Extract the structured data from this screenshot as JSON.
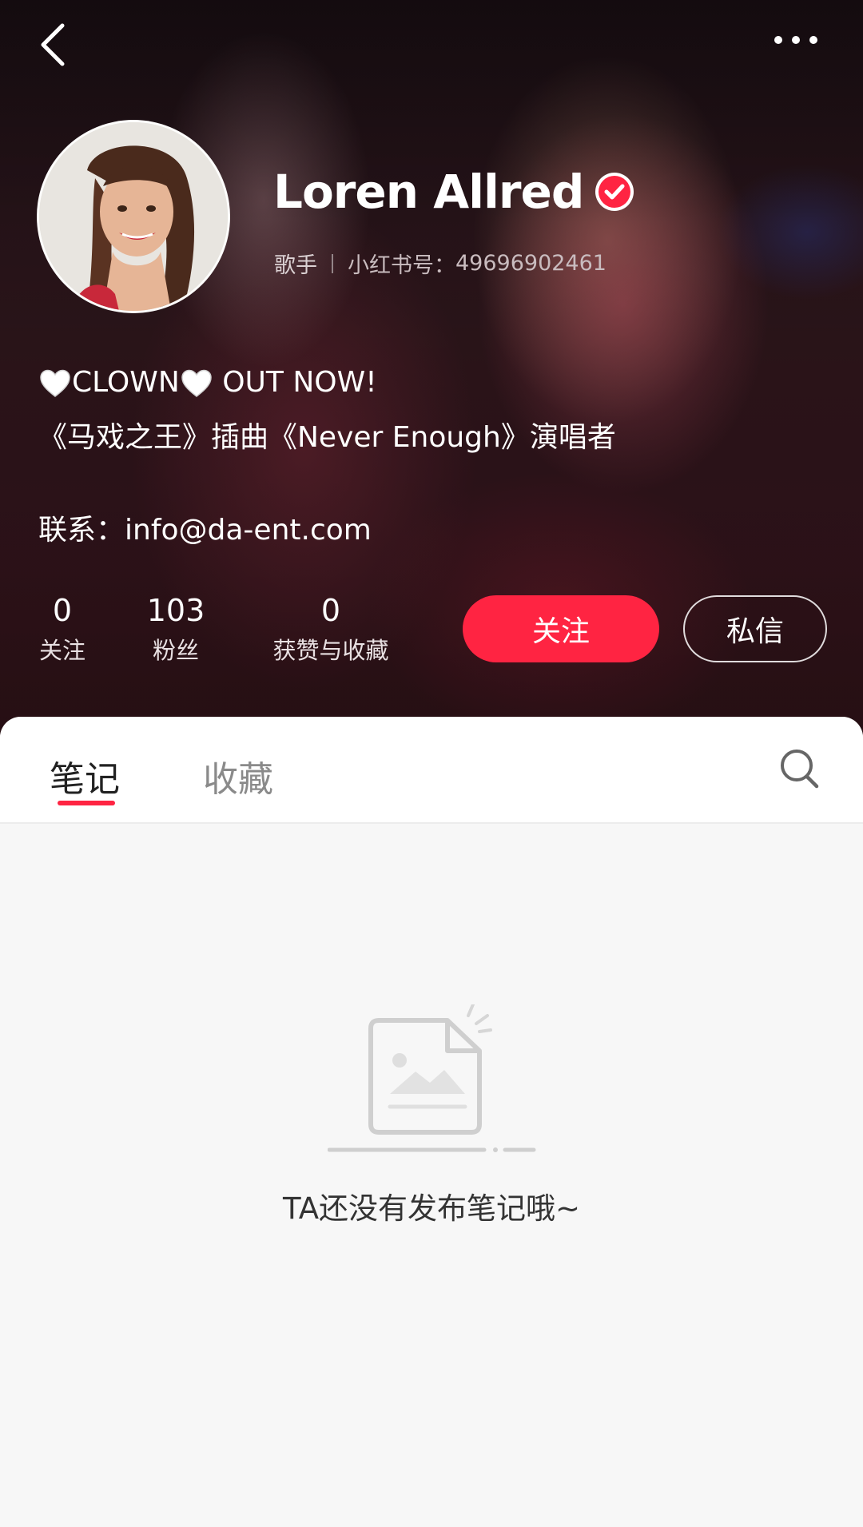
{
  "profile": {
    "name": "Loren Allred",
    "role": "歌手",
    "id_label": "小红书号：",
    "id_value": "49696902461",
    "bio_line1_text1": "CLOWN",
    "bio_line1_text2": " OUT NOW!",
    "bio_line2": "《马戏之王》插曲《Never Enough》演唱者",
    "contact": "联系：info@da-ent.com"
  },
  "stats": [
    {
      "value": "0",
      "label": "关注"
    },
    {
      "value": "103",
      "label": "粉丝"
    },
    {
      "value": "0",
      "label": "获赞与收藏"
    }
  ],
  "actions": {
    "follow": "关注",
    "message": "私信"
  },
  "tabs": [
    {
      "label": "笔记",
      "active": true
    },
    {
      "label": "收藏",
      "active": false
    }
  ],
  "empty_state": {
    "text": "TA还没有发布笔记哦~"
  },
  "colors": {
    "accent": "#ff2442",
    "background": "#f7f7f7"
  },
  "icons": [
    "back-icon",
    "more-icon",
    "verified-icon",
    "heart-icon",
    "search-icon",
    "empty-note-icon"
  ]
}
